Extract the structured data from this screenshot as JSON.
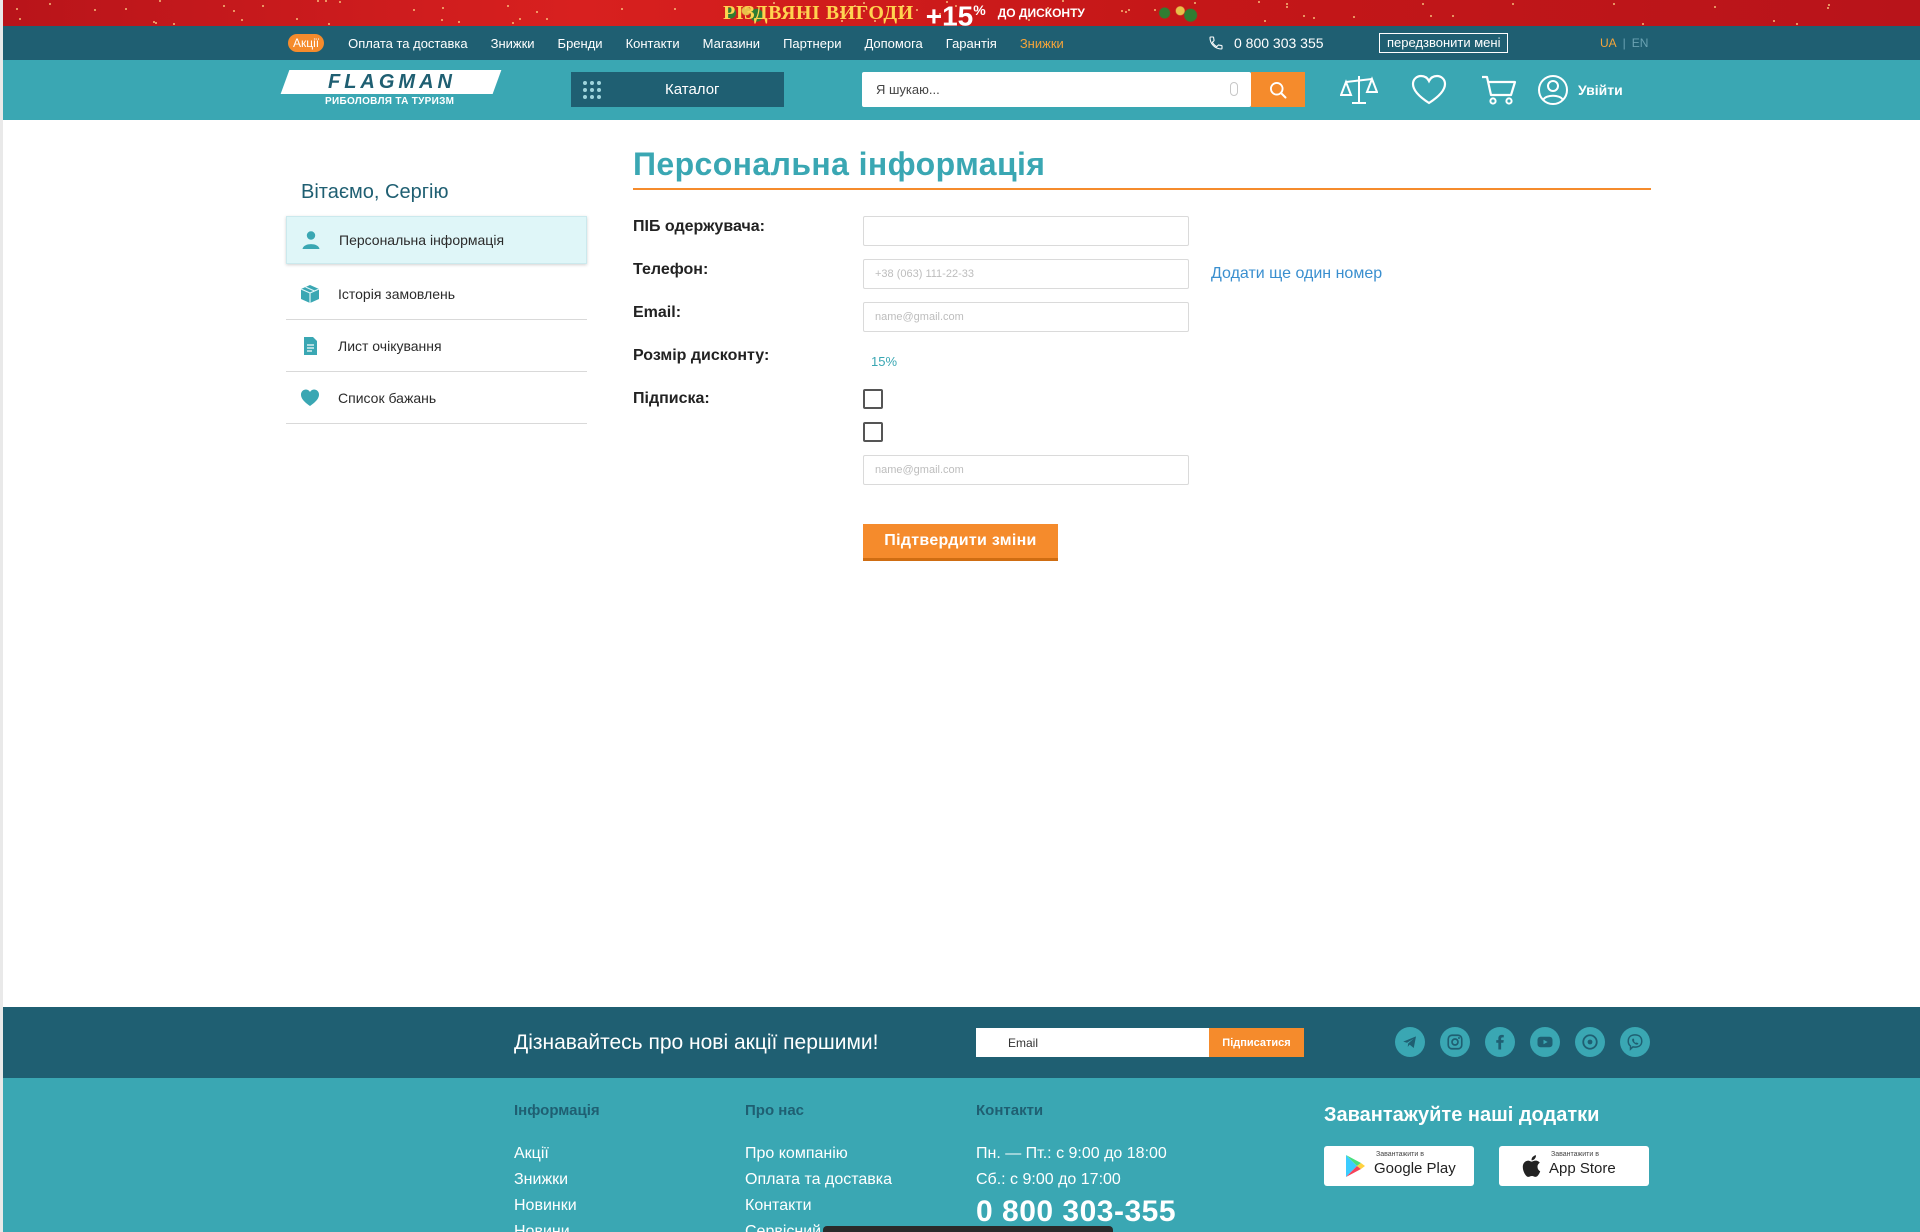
{
  "promo": {
    "title": "РІЗДВЯНІ ВИГОДИ",
    "percent": "+15",
    "percent_sign": "%",
    "subtitle": "ДО ДИСКОНТУ"
  },
  "topnav": {
    "promo_label": "Акції",
    "links": [
      "Оплата та доставка",
      "Знижки",
      "Бренди",
      "Контакти",
      "Магазини",
      "Партнери",
      "Допомога",
      "Гарантія"
    ],
    "highlight_link": "Знижки",
    "phone": "0 800 303 355",
    "callback_label": "передзвонити мені",
    "lang_active": "UA",
    "lang_other": "EN",
    "lang_sep": "|"
  },
  "header": {
    "logo_text": "FLAGMAN",
    "logo_subtitle": "РИБОЛОВЛЯ ТА ТУРИЗМ",
    "catalog_label": "Каталог",
    "search_placeholder": "Я шукаю...",
    "login_label": "Увійти",
    "icons": [
      "compare-icon",
      "heart-icon",
      "cart-icon",
      "user-icon"
    ]
  },
  "sidebar": {
    "greeting": "Вітаємо, Сергію",
    "items": [
      {
        "label": "Персональна інформація",
        "icon": "person-icon",
        "active": true
      },
      {
        "label": "Історія замовлень",
        "icon": "box-icon",
        "active": false
      },
      {
        "label": "Лист очікування",
        "icon": "document-icon",
        "active": false
      },
      {
        "label": "Список бажань",
        "icon": "heart-icon",
        "active": false
      }
    ]
  },
  "form": {
    "title": "Персональна інформація",
    "labels": {
      "name": "ПІБ одержувача:",
      "phone": "Телефон:",
      "email": "Email:",
      "discount": "Розмір дисконту:",
      "subscription": "Підписка:"
    },
    "name_value": "",
    "phone_placeholder": "+38 (063) 111-22-33",
    "email_placeholder": "name@gmail.com",
    "sub_email_placeholder": "name@gmail.com",
    "add_phone": "Додати ще один номер",
    "discount_value": "15%",
    "submit_label": "Підтвердити зміни"
  },
  "footer": {
    "cta": "Дізнавайтесь про нові акції першими!",
    "email_placeholder": "Email",
    "subscribe_label": "Підписатися",
    "socials": [
      "telegram-icon",
      "instagram-icon",
      "facebook-icon",
      "youtube-icon",
      "tiktok-icon",
      "viber-icon"
    ],
    "columns": [
      {
        "heading": "Інформація",
        "links": [
          "Акції",
          "Знижки",
          "Новинки",
          "Новини"
        ]
      },
      {
        "heading": "Про нас",
        "links": [
          "Про компанію",
          "Оплата та доставка",
          "Контакти",
          "Сервісний"
        ]
      },
      {
        "heading": "Контакти",
        "links": [
          "Пн. — Пт.: с 9:00 до 18:00",
          "Сб.: с 9:00 до 17:00"
        ],
        "phone": "0 800 303-355"
      }
    ],
    "apps_heading": "Завантажуйте наші додатки",
    "google": {
      "small": "Завантажити в",
      "name": "Google Play"
    },
    "apple": {
      "small": "Завантажити в",
      "name": "App Store"
    }
  },
  "colors": {
    "teal": "#3aa7b3",
    "dark_teal": "#1f5f72",
    "orange": "#f58b2c",
    "promo_red": "#c51718"
  }
}
